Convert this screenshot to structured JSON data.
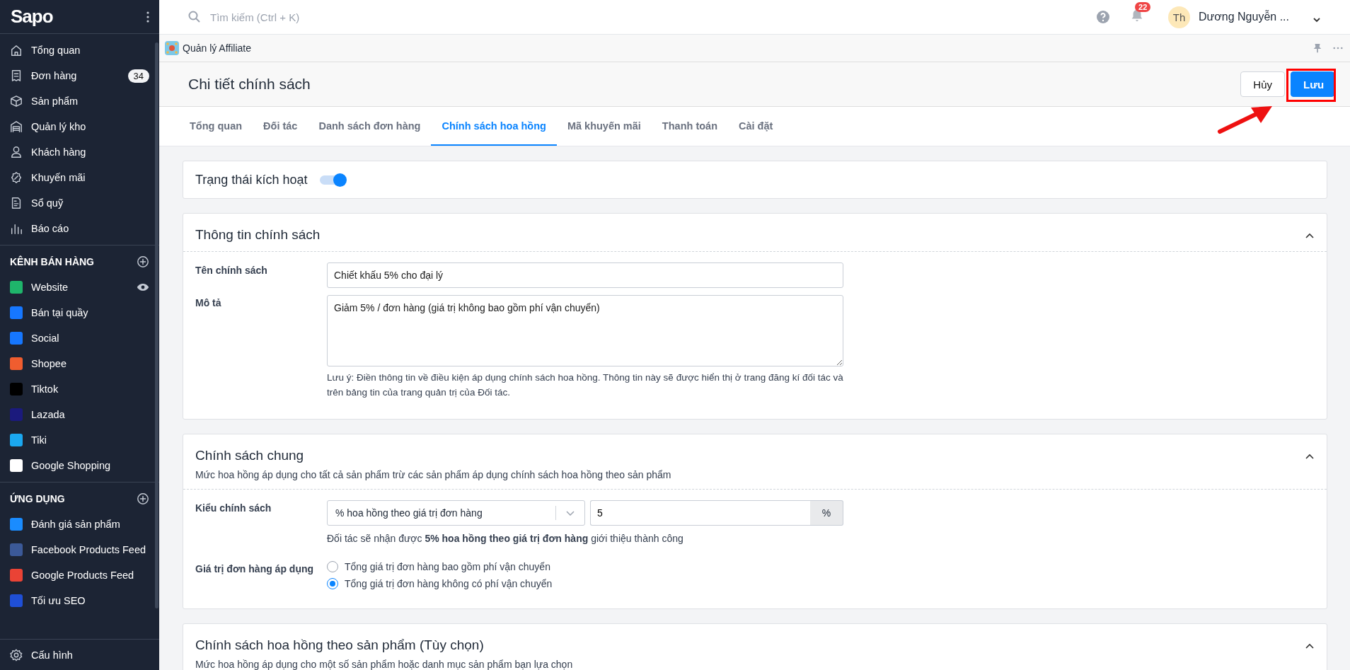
{
  "sidebar": {
    "logo": "Sapo",
    "nav": [
      {
        "label": "Tổng quan"
      },
      {
        "label": "Đơn hàng",
        "badge": "34"
      },
      {
        "label": "Sản phẩm"
      },
      {
        "label": "Quản lý kho"
      },
      {
        "label": "Khách hàng"
      },
      {
        "label": "Khuyến mãi"
      },
      {
        "label": "Sổ quỹ"
      },
      {
        "label": "Báo cáo"
      }
    ],
    "channels_heading": "KÊNH BÁN HÀNG",
    "channels": [
      {
        "label": "Website",
        "color": "#1fb56b"
      },
      {
        "label": "Bán tại quầy",
        "color": "#1677ff"
      },
      {
        "label": "Social",
        "color": "#1677ff"
      },
      {
        "label": "Shopee",
        "color": "#f05d2f"
      },
      {
        "label": "Tiktok",
        "color": "#000000"
      },
      {
        "label": "Lazada",
        "color": "#1b1a7d"
      },
      {
        "label": "Tiki",
        "color": "#1ba8f0"
      },
      {
        "label": "Google Shopping",
        "color": "#ffffff"
      }
    ],
    "apps_heading": "ỨNG DỤNG",
    "apps": [
      {
        "label": "Đánh giá sản phẩm",
        "color": "#1a8cff"
      },
      {
        "label": "Facebook Products Feed",
        "color": "#3b5998"
      },
      {
        "label": "Google Products Feed",
        "color": "#ea4335"
      },
      {
        "label": "Tối ưu SEO",
        "color": "#1f4fd6"
      }
    ],
    "footer": "Cấu hình"
  },
  "topbar": {
    "search_placeholder": "Tìm kiếm (Ctrl + K)",
    "notifications": "22",
    "avatar": "Th",
    "user": "Dương Nguyễn ..."
  },
  "app_bar": {
    "title": "Quản lý Affiliate"
  },
  "page": {
    "title": "Chi tiết chính sách",
    "buttons": [
      {
        "label": "Hủy",
        "kind": "secondary"
      },
      {
        "label": "Lưu",
        "kind": "primary"
      }
    ]
  },
  "tabs": [
    {
      "label": "Tổng quan",
      "selected": false
    },
    {
      "label": "Đối tác",
      "selected": false
    },
    {
      "label": "Danh sách đơn hàng",
      "selected": false
    },
    {
      "label": "Chính sách hoa hồng",
      "selected": true
    },
    {
      "label": "Mã khuyến mãi",
      "selected": false
    },
    {
      "label": "Thanh toán",
      "selected": false
    },
    {
      "label": "Cài đặt",
      "selected": false
    }
  ],
  "status_card": {
    "label": "Trạng thái kích hoạt",
    "on": true
  },
  "info_card": {
    "title": "Thông tin chính sách",
    "expanded": true,
    "name_label": "Tên chính sách",
    "name_value": "Chiết khấu 5% cho đại lý",
    "desc_label": "Mô tả",
    "desc_value": "Giảm 5% / đơn hàng (giá trị không bao gồm phí vận chuyển)",
    "note": "Lưu ý: Điền thông tin về điều kiện áp dụng chính sách hoa hồng. Thông tin này sẽ được hiển thị ở trang đăng kí đối tác và trên bảng tin của trang quản trị của Đối tác."
  },
  "general_card": {
    "title": "Chính sách chung",
    "subtitle": "Mức hoa hồng áp dụng cho tất cả sản phẩm trừ các sản phẩm áp dụng chính sách hoa hồng theo sản phẩm",
    "expanded": true,
    "type_label": "Kiểu chính sách",
    "type_value": "% hoa hồng theo giá trị đơn hàng",
    "rate_value": "5",
    "rate_unit": "%",
    "summary": "Đối tác sẽ nhận được **5% hoa hồng theo giá trị đơn hàng** giới thiệu thành công",
    "order_label": "Giá trị đơn hàng áp dụng",
    "options": [
      {
        "label": "Tổng giá trị đơn hàng bao gồm phí vận chuyển",
        "selected": false
      },
      {
        "label": "Tổng giá trị đơn hàng không có phí vận chuyển",
        "selected": true
      }
    ]
  },
  "product_card": {
    "title": "Chính sách hoa hồng theo sản phẩm (Tùy chọn)",
    "subtitle": "Mức hoa hồng áp dụng cho một số sản phẩm hoặc danh mục sản phẩm bạn lựa chọn",
    "expanded": true
  }
}
